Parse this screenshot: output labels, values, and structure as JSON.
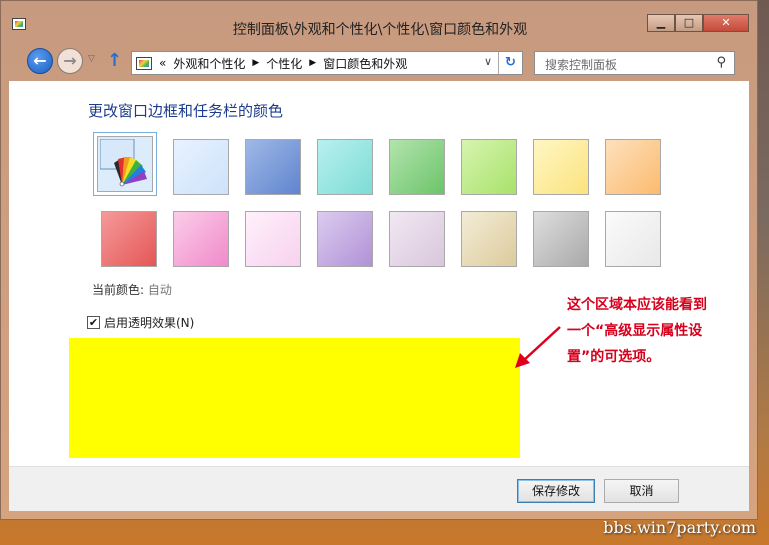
{
  "window": {
    "title": "控制面板\\外观和个性化\\个性化\\窗口颜色和外观",
    "controls": {
      "minimize": "▁",
      "maximize": "□",
      "close": "✕"
    }
  },
  "nav": {
    "back_glyph": "←",
    "forward_glyph": "→",
    "dropdown_glyph": "▽",
    "up_glyph": "↑",
    "address": {
      "overflow": "«",
      "segments": [
        "外观和个性化",
        "个性化",
        "窗口颜色和外观"
      ],
      "separator": "▶",
      "dropdown_glyph": "∨",
      "refresh_glyph": "↻"
    },
    "search": {
      "placeholder": "搜索控制面板",
      "icon": "⚲"
    }
  },
  "main": {
    "heading": "更改窗口边框和任务栏的颜色",
    "swatches": [
      {
        "id": "custom-palette",
        "icon": "color-palette-icon",
        "selected": true
      },
      {
        "id": "sky",
        "color": "#dcecfd"
      },
      {
        "id": "twilight",
        "color": "#7fa0dc"
      },
      {
        "id": "sea-foam",
        "color": "#9ee8e4"
      },
      {
        "id": "leaf",
        "color": "#8fd58c"
      },
      {
        "id": "lime",
        "color": "#bdeb88"
      },
      {
        "id": "sun",
        "color": "#fdeea0"
      },
      {
        "id": "pumpkin",
        "color": "#fdcd95"
      },
      {
        "id": "blush",
        "color": "#f07c7c"
      },
      {
        "id": "violet",
        "color": "#f7b0dc"
      },
      {
        "id": "lavender",
        "color": "#fbe2f6"
      },
      {
        "id": "taupe",
        "color": "#c7b2e2"
      },
      {
        "id": "chocolate",
        "color": "#e6d6e8"
      },
      {
        "id": "slate",
        "color": "#e8dcbb"
      },
      {
        "id": "fog",
        "color": "#c6c6c6"
      },
      {
        "id": "frost",
        "color": "#f4f4f4"
      }
    ],
    "current_color_label": "当前颜色:",
    "current_color_value": "自动",
    "transparency_label": "启用透明效果(N)",
    "transparency_checked": true,
    "highlight_color": "#ffff00"
  },
  "annotation": {
    "lines": [
      "这个区域本应该能看到",
      "一个“高级显示属性设",
      "置”的可选项。"
    ],
    "color": "#d6001c"
  },
  "footer": {
    "save_label": "保存修改",
    "cancel_label": "取消"
  },
  "watermark": "bbs.win7party.com"
}
